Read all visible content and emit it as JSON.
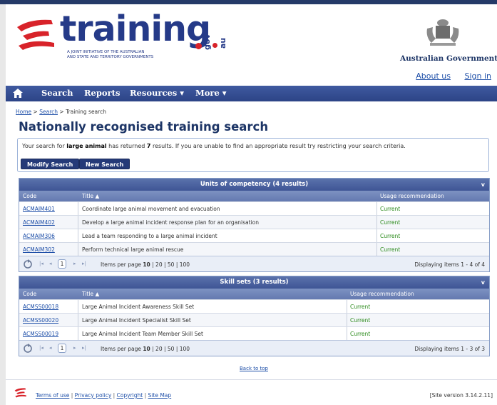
{
  "logo": {
    "word": "training",
    "gov": "gov",
    "au": "au",
    "tagline_1": "A JOINT INITIATIVE OF THE AUSTRALIAN",
    "tagline_2": "AND STATE AND TERRITORY GOVERNMENTS",
    "brand_color": "#253a88",
    "accent_color": "#d8232a"
  },
  "government": {
    "name": "Australian Government"
  },
  "top_links": {
    "about": "About us",
    "signin": "Sign in"
  },
  "nav": {
    "home_icon": "home-icon",
    "search": "Search",
    "reports": "Reports",
    "resources": "Resources ▾",
    "more": "More ▾"
  },
  "breadcrumb": {
    "home": "Home",
    "sep1": " > ",
    "search": "Search",
    "sep2": " > ",
    "current": "Training search"
  },
  "page_title": "Nationally recognised training search",
  "summary": {
    "prefix": "Your search for ",
    "term": "large animal",
    "middle": " has returned ",
    "count": "7",
    "suffix": " results.  If you are unable to find an appropriate result try restricting your search criteria.",
    "modify_button": "Modify Search",
    "new_button": "New Search"
  },
  "units": {
    "title": "Units of competency (4 results)",
    "collapse": "v",
    "headers": {
      "code": "Code",
      "title": "Title ▲",
      "usage": "Usage recommendation"
    },
    "rows": [
      {
        "code": "ACMAIM401",
        "title": "Coordinate large animal movement and evacuation",
        "usage": "Current"
      },
      {
        "code": "ACMAIM402",
        "title": "Develop a large animal incident response plan for an organisation",
        "usage": "Current"
      },
      {
        "code": "ACMAIM306",
        "title": "Lead a team responding to a large animal incident",
        "usage": "Current"
      },
      {
        "code": "ACMAIM302",
        "title": "Perform technical large animal rescue",
        "usage": "Current"
      }
    ],
    "pager": {
      "first": "|◂",
      "prev": "◂",
      "page": "1",
      "next": "▸",
      "last": "▸|",
      "ipp_label": "Items per page ",
      "ipp_selected": "10",
      "ipp_rest": " | 20 | 50 | 100",
      "display": "Displaying items 1 - 4 of 4"
    }
  },
  "skillsets": {
    "title": "Skill sets (3 results)",
    "collapse": "v",
    "headers": {
      "code": "Code",
      "title": "Title ▲",
      "usage": "Usage recommendation"
    },
    "rows": [
      {
        "code": "ACMSS00018",
        "title": "Large Animal Incident Awareness Skill Set",
        "usage": "Current"
      },
      {
        "code": "ACMSS00020",
        "title": "Large Animal Incident Specialist Skill Set",
        "usage": "Current"
      },
      {
        "code": "ACMSS00019",
        "title": "Large Animal Incident Team Member Skill Set",
        "usage": "Current"
      }
    ],
    "pager": {
      "first": "|◂",
      "prev": "◂",
      "page": "1",
      "next": "▸",
      "last": "▸|",
      "ipp_label": "Items per page ",
      "ipp_selected": "10",
      "ipp_rest": " | 20 | 50 | 100",
      "display": "Displaying items 1 - 3 of 3"
    }
  },
  "back_to_top": "Back to top",
  "footer": {
    "terms": "Terms of use",
    "sep": " | ",
    "privacy": "Privacy policy",
    "copyright": "Copyright",
    "sitemap": "Site Map",
    "version": "[Site version 3.14.2.11]"
  }
}
